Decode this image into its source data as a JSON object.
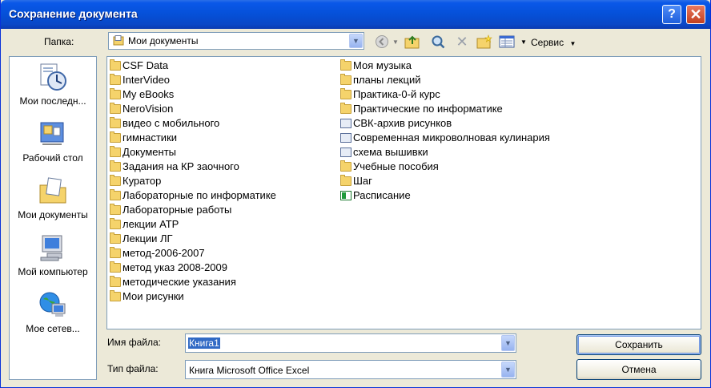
{
  "window": {
    "title": "Сохранение документа",
    "help_glyph": "?",
    "close_glyph": "✕"
  },
  "toolbar": {
    "folder_label": "Папка:",
    "folder_value": "Мои документы",
    "service_label": "Сервис"
  },
  "places": [
    {
      "label": "Мои последн...",
      "icon": "recent-docs-icon"
    },
    {
      "label": "Рабочий стол",
      "icon": "desktop-icon"
    },
    {
      "label": "Мои документы",
      "icon": "my-documents-icon"
    },
    {
      "label": "Мой компьютер",
      "icon": "my-computer-icon"
    },
    {
      "label": "Мое сетев...",
      "icon": "network-places-icon"
    }
  ],
  "files_col1": [
    {
      "name": "CSF Data",
      "type": "folder"
    },
    {
      "name": "InterVideo",
      "type": "folder"
    },
    {
      "name": "My eBooks",
      "type": "folder"
    },
    {
      "name": "NeroVision",
      "type": "folder"
    },
    {
      "name": "видео с мобильного",
      "type": "folder"
    },
    {
      "name": "гимнастики",
      "type": "folder"
    },
    {
      "name": "Документы",
      "type": "folder"
    },
    {
      "name": "Задания на КР заочного",
      "type": "folder"
    },
    {
      "name": "Куратор",
      "type": "folder"
    },
    {
      "name": "Лабораторные по информатике",
      "type": "folder"
    },
    {
      "name": "Лабораторные работы",
      "type": "folder"
    },
    {
      "name": "лекции АТР",
      "type": "folder"
    },
    {
      "name": "Лекции ЛГ",
      "type": "folder"
    },
    {
      "name": "метод-2006-2007",
      "type": "folder"
    },
    {
      "name": "метод указ 2008-2009",
      "type": "folder"
    },
    {
      "name": "методические указания",
      "type": "folder"
    },
    {
      "name": "Мои рисунки",
      "type": "folder"
    }
  ],
  "files_col2": [
    {
      "name": "Моя музыка",
      "type": "folder"
    },
    {
      "name": "планы лекций",
      "type": "folder"
    },
    {
      "name": "Практика-0-й курс",
      "type": "folder"
    },
    {
      "name": "Практические по информатике",
      "type": "folder"
    },
    {
      "name": "СВК-архив рисунков",
      "type": "doc"
    },
    {
      "name": "Современная микроволновая кулинария",
      "type": "doc"
    },
    {
      "name": "схема вышивки",
      "type": "doc"
    },
    {
      "name": "Учебные пособия",
      "type": "folder"
    },
    {
      "name": "Шаг",
      "type": "folder"
    },
    {
      "name": "Расписание",
      "type": "xls"
    }
  ],
  "form": {
    "filename_label": "Имя файла:",
    "filename_value": "Книга1",
    "filetype_label": "Тип файла:",
    "filetype_value": "Книга Microsoft Office Excel",
    "save_label": "Сохранить",
    "cancel_label": "Отмена"
  }
}
